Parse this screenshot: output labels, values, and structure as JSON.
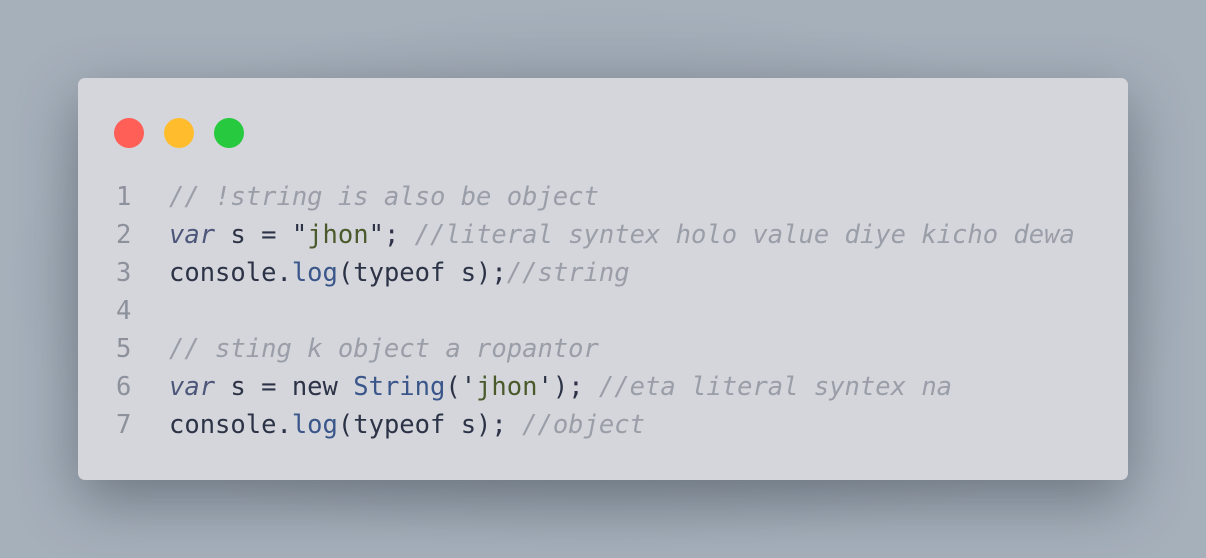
{
  "window": {
    "controls": [
      {
        "name": "close",
        "color": "#ff5f56"
      },
      {
        "name": "minimize",
        "color": "#ffbd2e"
      },
      {
        "name": "maximize",
        "color": "#27c93f"
      }
    ]
  },
  "code": {
    "lines": [
      {
        "number": "1",
        "tokens": [
          {
            "type": "comment",
            "text": "// !string is also be object"
          }
        ]
      },
      {
        "number": "2",
        "tokens": [
          {
            "type": "kw",
            "text": "var"
          },
          {
            "type": "plain",
            "text": " s = \""
          },
          {
            "type": "str",
            "text": "jhon"
          },
          {
            "type": "plain",
            "text": "\"; "
          },
          {
            "type": "comment",
            "text": "//literal syntex holo value diye kicho dewa"
          }
        ]
      },
      {
        "number": "3",
        "tokens": [
          {
            "type": "plain",
            "text": "console."
          },
          {
            "type": "fn",
            "text": "log"
          },
          {
            "type": "plain",
            "text": "(typeof s);"
          },
          {
            "type": "comment",
            "text": "//string"
          }
        ]
      },
      {
        "number": "4",
        "tokens": []
      },
      {
        "number": "5",
        "tokens": [
          {
            "type": "comment",
            "text": "// sting k object a ropantor"
          }
        ]
      },
      {
        "number": "6",
        "tokens": [
          {
            "type": "kw",
            "text": "var"
          },
          {
            "type": "plain",
            "text": " s = new "
          },
          {
            "type": "cls",
            "text": "String"
          },
          {
            "type": "plain",
            "text": "('"
          },
          {
            "type": "str",
            "text": "jhon"
          },
          {
            "type": "plain",
            "text": "'); "
          },
          {
            "type": "comment",
            "text": "//eta literal syntex na"
          }
        ]
      },
      {
        "number": "7",
        "tokens": [
          {
            "type": "plain",
            "text": "console."
          },
          {
            "type": "fn",
            "text": "log"
          },
          {
            "type": "plain",
            "text": "(typeof s); "
          },
          {
            "type": "comment",
            "text": "//object"
          }
        ]
      }
    ]
  }
}
